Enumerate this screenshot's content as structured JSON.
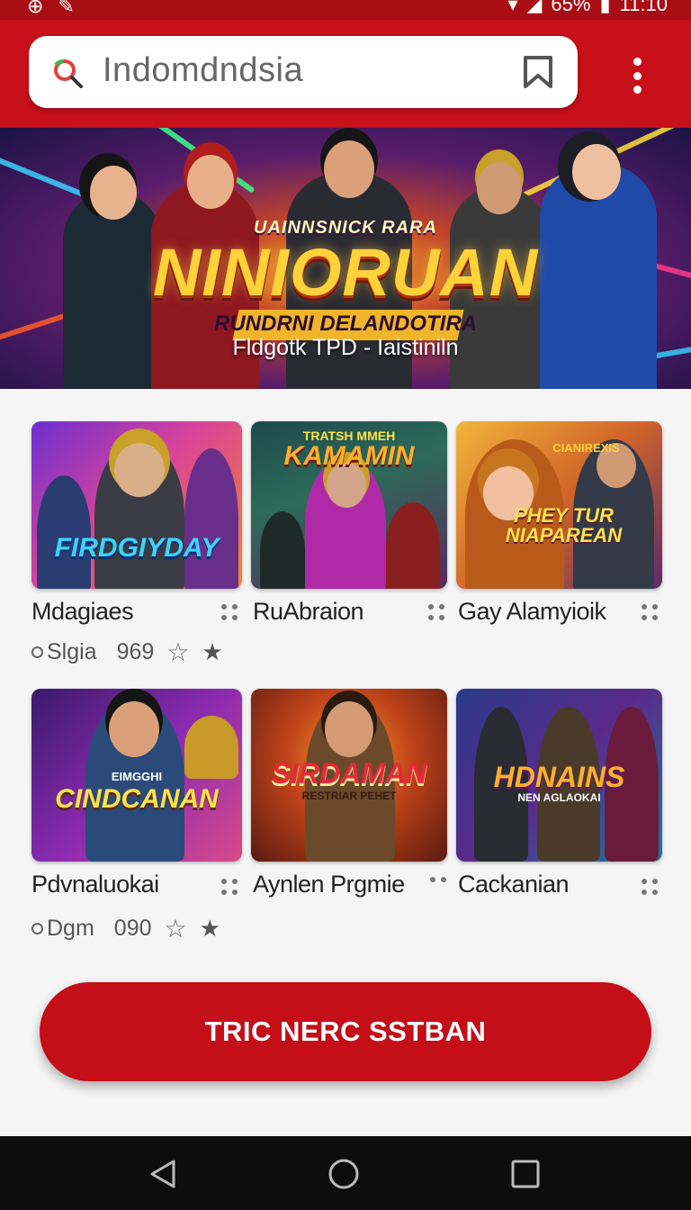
{
  "status_bar": {
    "battery": "65%",
    "time": "11:10"
  },
  "search": {
    "text": "Indomdndsia"
  },
  "hero": {
    "kicker": "UAINNSNICK RARA",
    "title": "NINIORUAN",
    "subtitle": "RUNDRNI DELANDOTIRA",
    "tagline": "Fldgotk TPD - Iaistiniln"
  },
  "games": [
    {
      "thumb_title": "FIRDGIYDAY",
      "thumb_sub": "",
      "name": "Mdagiaes",
      "meta_label": "Slgia",
      "meta_count": "969"
    },
    {
      "thumb_title": "KAMAMIN",
      "thumb_sub": "TRATSH MMEH",
      "name": "RuAbraion",
      "meta_label": "",
      "meta_count": ""
    },
    {
      "thumb_title": "PHEY TUR NIAPAREAN",
      "thumb_sub": "CIANIREXIS",
      "name": "Gay Alamyioik",
      "meta_label": "",
      "meta_count": ""
    },
    {
      "thumb_title": "CINDCANAN",
      "thumb_sub": "EIMGGHI",
      "name": "Pdvnaluokai",
      "meta_label": "Dgm",
      "meta_count": "090"
    },
    {
      "thumb_title": "SIRDAMAN",
      "thumb_sub": "RESTRIAR PEHET",
      "name": "Aynlen Prgmie",
      "meta_label": "",
      "meta_count": ""
    },
    {
      "thumb_title": "HDNAINS",
      "thumb_sub": "NEN AGLAOKAI",
      "name": "Cackanian",
      "meta_label": "",
      "meta_count": ""
    }
  ],
  "cta": {
    "label": "TRIC NERC SSTBAN"
  },
  "colors": {
    "brand_red": "#c8101a",
    "status_red": "#a80e14",
    "nav_black": "#0d0d0d"
  },
  "icons": [
    "search-icon",
    "bookmark-icon",
    "more-vert-icon",
    "back-icon",
    "home-icon",
    "recents-icon",
    "wifi-icon",
    "signal-icon",
    "battery-icon"
  ]
}
